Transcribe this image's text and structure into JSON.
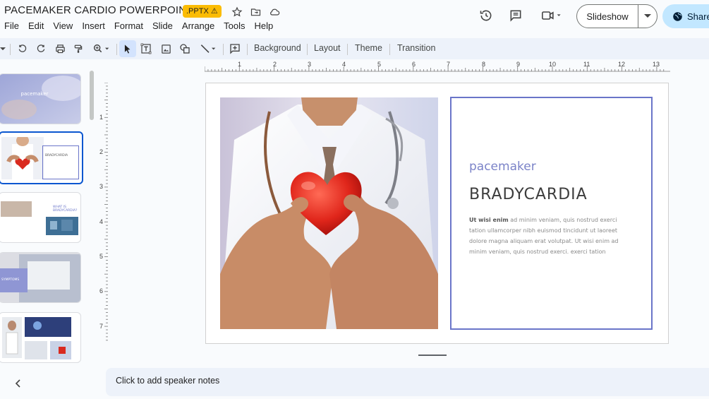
{
  "title": "PACEMAKER CARDIO POWERPOINT",
  "file_badge": ".PPTX ⚠",
  "menu": [
    "File",
    "Edit",
    "View",
    "Insert",
    "Format",
    "Slide",
    "Arrange",
    "Tools",
    "Help"
  ],
  "buttons": {
    "slideshow": "Slideshow",
    "share": "Share"
  },
  "toolbar": {
    "background": "Background",
    "layout": "Layout",
    "theme": "Theme",
    "transition": "Transition"
  },
  "ruler_h": [
    "1",
    "2",
    "3",
    "4",
    "5",
    "6",
    "7",
    "8",
    "9",
    "10",
    "11",
    "12",
    "13"
  ],
  "ruler_v": [
    "1",
    "2",
    "3",
    "4",
    "5",
    "6",
    "7"
  ],
  "slide": {
    "subtitle": "pacemaker",
    "heading": "BRADYCARDIA",
    "body_bold": "Ut wisi enim",
    "body_rest": " ad minim veniam, quis nostrud exerci tation ullamcorper nibh euismod tincidunt ut laoreet dolore magna aliquam erat volutpat. Ut wisi enim ad minim veniam, quis nostrud exerci. exerci tation"
  },
  "thumbnails": {
    "t1_title": "pacemaker",
    "t2_title": "BRADYCARDIA",
    "t3_title": "WHAT IS BRADYCARDIA?",
    "t4_title": "SYMPTOMS"
  },
  "speaker_notes_placeholder": "Click to add speaker notes",
  "colors": {
    "accent": "#6a75c9",
    "badge": "#fbbc04",
    "share_bg": "#c2e7ff",
    "selection": "#0b57d0"
  }
}
